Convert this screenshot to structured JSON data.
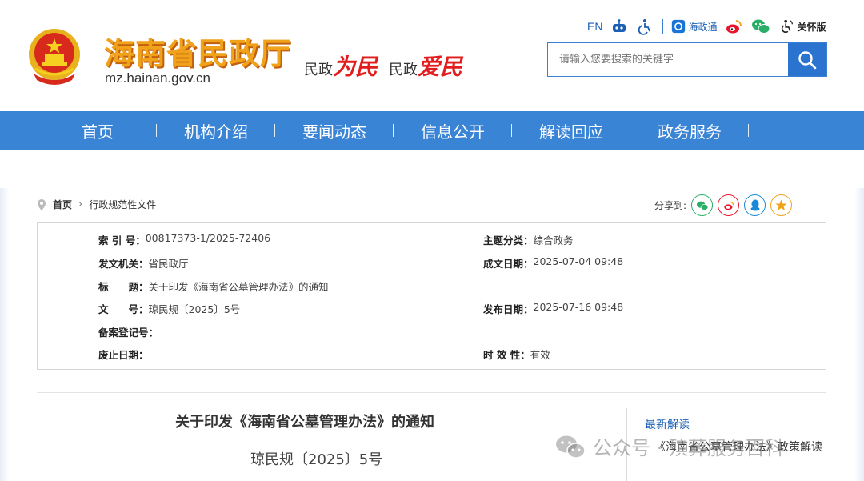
{
  "header": {
    "site_title": "海南省民政厅",
    "domain": "mz.hainan.gov.cn",
    "slogan": {
      "part1_prefix": "民政",
      "part1_red": "为民",
      "part2_prefix": "民政",
      "part2_red": "爱民"
    },
    "toolbar": {
      "en_label": "EN",
      "hzt_label": "海政通",
      "care_label": "关怀版"
    },
    "search": {
      "placeholder": "请输入您要搜索的关键字"
    }
  },
  "nav": {
    "items": [
      "首页",
      "机构介绍",
      "要闻动态",
      "信息公开",
      "解读回应",
      "政务服务"
    ]
  },
  "breadcrumb": {
    "home": "首页",
    "current": "行政规范性文件"
  },
  "share": {
    "label": "分享到:"
  },
  "meta": {
    "index_label": "索 引 号：",
    "index_value": "00817373-1/2025-72406",
    "category_label": "主题分类：",
    "category_value": "综合政务",
    "issuer_label": "发文机关：",
    "issuer_value": "省民政厅",
    "created_label": "成文日期：",
    "created_value": "2025-07-04 09:48",
    "title_label": "标　　题：",
    "title_value": "关于印发《海南省公墓管理办法》的通知",
    "docno_label": "文　　号：",
    "docno_value": "琼民规〔2025〕5号",
    "published_label": "发布日期：",
    "published_value": "2025-07-16 09:48",
    "record_label": "备案登记号：",
    "record_value": "",
    "repeal_label": "废止日期：",
    "repeal_value": "",
    "validity_label": "时 效 性：",
    "validity_value": "有效"
  },
  "document": {
    "title": "关于印发《海南省公墓管理办法》的通知",
    "number": "琼民规〔2025〕5号"
  },
  "sidebar": {
    "latest_heading": "最新解读",
    "latest_item": "《海南省公墓管理办法》政策解读"
  },
  "watermark": {
    "text": "公众号 · 殡葬服务百科"
  },
  "colors": {
    "nav_blue": "#3a84d6",
    "title_orange": "#f0a21b",
    "slogan_red": "#e11d1d",
    "link_blue": "#1a5fb4"
  }
}
